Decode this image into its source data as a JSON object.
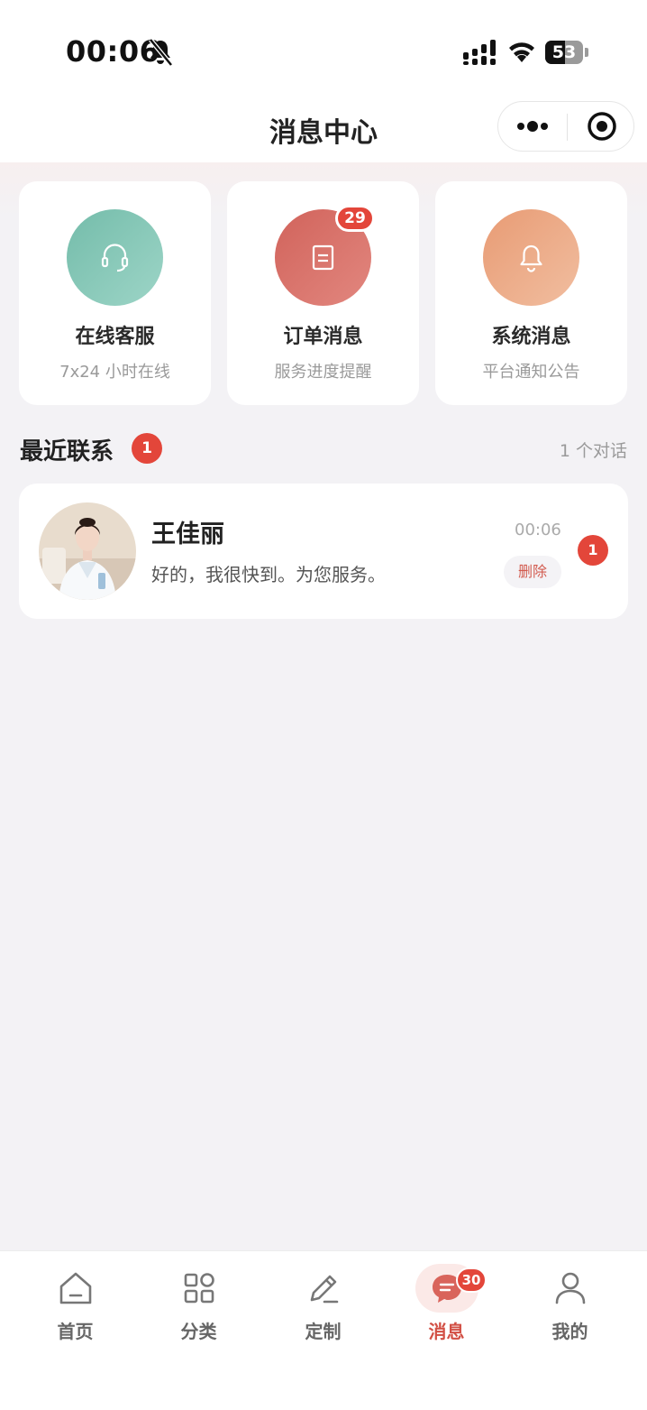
{
  "status_bar": {
    "time": "00:06",
    "battery": "53",
    "battery_level": 0.53
  },
  "nav": {
    "title": "消息中心"
  },
  "cards": [
    {
      "title": "在线客服",
      "subtitle": "7x24 小时在线",
      "icon": "headset-icon",
      "badge": ""
    },
    {
      "title": "订单消息",
      "subtitle": "服务进度提醒",
      "icon": "document-icon",
      "badge": "29"
    },
    {
      "title": "系统消息",
      "subtitle": "平台通知公告",
      "icon": "bell-icon",
      "badge": ""
    }
  ],
  "recent": {
    "title": "最近联系",
    "badge": "1",
    "count": "1 个对话",
    "conversations": [
      {
        "name": "王佳丽",
        "message": "好的，我很快到。为您服务。",
        "time": "00:06",
        "delete_label": "删除",
        "unread": "1"
      }
    ]
  },
  "tabbar": {
    "tabs": [
      {
        "label": "首页",
        "icon": "home-icon"
      },
      {
        "label": "分类",
        "icon": "grid-icon"
      },
      {
        "label": "定制",
        "icon": "pencil-icon"
      },
      {
        "label": "消息",
        "icon": "message-icon",
        "badge": "30",
        "active": true
      },
      {
        "label": "我的",
        "icon": "user-icon"
      }
    ]
  },
  "colors": {
    "accent": "#e3463a",
    "active_tab": "#d24f44",
    "card_teal": "#7fc4b3",
    "card_red": "#d9726a",
    "card_orange": "#eba47e"
  }
}
